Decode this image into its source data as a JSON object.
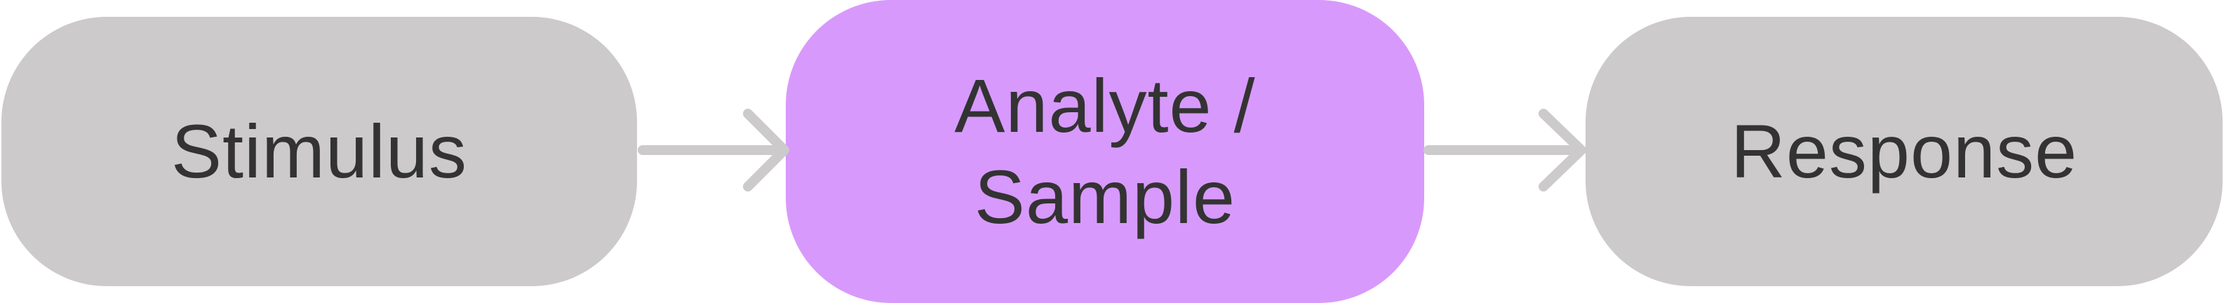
{
  "diagram": {
    "nodes": [
      {
        "id": "stimulus",
        "label": "Stimulus",
        "fill": "#cccaca"
      },
      {
        "id": "analyte",
        "label": "Analyte /\nSample",
        "fill": "#d899fc"
      },
      {
        "id": "response",
        "label": "Response",
        "fill": "#cccaca"
      }
    ],
    "edges": [
      {
        "from": "stimulus",
        "to": "analyte"
      },
      {
        "from": "analyte",
        "to": "response"
      }
    ],
    "text_color": "#333333",
    "arrow_color": "#cccaca"
  }
}
